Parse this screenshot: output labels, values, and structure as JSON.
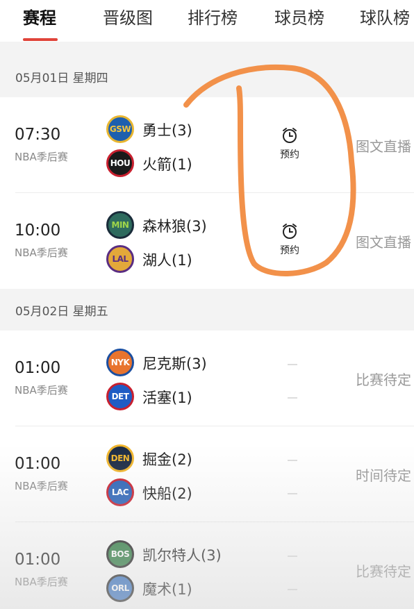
{
  "tabs": [
    {
      "label": "赛程"
    },
    {
      "label": "晋级图"
    },
    {
      "label": "排行榜"
    },
    {
      "label": "球员榜"
    },
    {
      "label": "球队榜"
    }
  ],
  "accent_color": "#e0443a",
  "annotation_color": "#f2914a",
  "days": [
    {
      "date": "05月01日 星期四"
    },
    {
      "date": "05月02日 星期五"
    }
  ],
  "games": [
    {
      "time": "07:30",
      "league": "NBA季后赛",
      "home": {
        "abbr": "GSW",
        "name": "勇士(3)",
        "color": "#1d5fae"
      },
      "away": {
        "abbr": "HOU",
        "name": "火箭(1)",
        "color": "#1a1a1a"
      },
      "action_label": "预约",
      "action_icon": "alarm-clock-icon",
      "status": "图文直播"
    },
    {
      "time": "10:00",
      "league": "NBA季后赛",
      "home": {
        "abbr": "MIN",
        "name": "森林狼(3)",
        "color": "#2e6b5e"
      },
      "away": {
        "abbr": "LAL",
        "name": "湖人(1)",
        "color": "#e3a83a"
      },
      "action_label": "预约",
      "action_icon": "alarm-clock-icon",
      "status": "图文直播"
    },
    {
      "time": "01:00",
      "league": "NBA季后赛",
      "home": {
        "abbr": "NYK",
        "name": "尼克斯(3)",
        "color": "#e8742e"
      },
      "away": {
        "abbr": "DET",
        "name": "活塞(1)",
        "color": "#1f5cc4"
      },
      "status": "比赛待定"
    },
    {
      "time": "01:00",
      "league": "NBA季后赛",
      "home": {
        "abbr": "DEN",
        "name": "掘金(2)",
        "color": "#1b2a44"
      },
      "away": {
        "abbr": "LAC",
        "name": "快船(2)",
        "color": "#2a63b8"
      },
      "status": "时间待定"
    },
    {
      "time": "01:00",
      "league": "NBA季后赛",
      "home": {
        "abbr": "BOS",
        "name": "凯尔特人(3)",
        "color": "#2a7a3e"
      },
      "away": {
        "abbr": "ORL",
        "name": "魔术(1)",
        "color": "#2d6cc0"
      },
      "status": "比赛待定"
    }
  ]
}
